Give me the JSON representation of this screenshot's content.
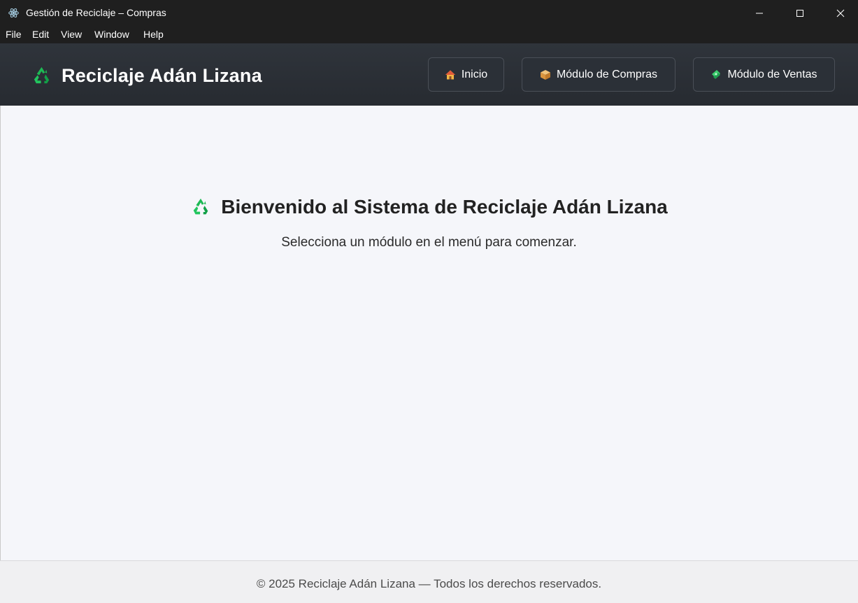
{
  "window": {
    "title": "Gestión de Reciclaje – Compras",
    "app_icon": "electron-icon",
    "controls": [
      "minimize-icon",
      "maximize-icon",
      "close-icon"
    ]
  },
  "menu": {
    "items": [
      "File",
      "Edit",
      "View",
      "Window",
      "Help"
    ]
  },
  "header": {
    "brand_icon": "recycle-icon",
    "brand_title": "Reciclaje Adán Lizana",
    "nav": [
      {
        "label": "Inicio",
        "icon": "house-icon"
      },
      {
        "label": "Módulo de Compras",
        "icon": "package-icon"
      },
      {
        "label": "Módulo de Ventas",
        "icon": "money-icon"
      }
    ]
  },
  "main": {
    "icon": "recycle-icon",
    "title": "Bienvenido al Sistema de Reciclaje Adán Lizana",
    "subtitle": "Selecciona un módulo en el menú para comenzar."
  },
  "footer": {
    "text": "© 2025 Reciclaje Adán Lizana — Todos los derechos reservados."
  },
  "colors": {
    "header_bg": "#2b3037",
    "content_bg": "#f5f6fa",
    "recycle_green": "#1db954"
  }
}
